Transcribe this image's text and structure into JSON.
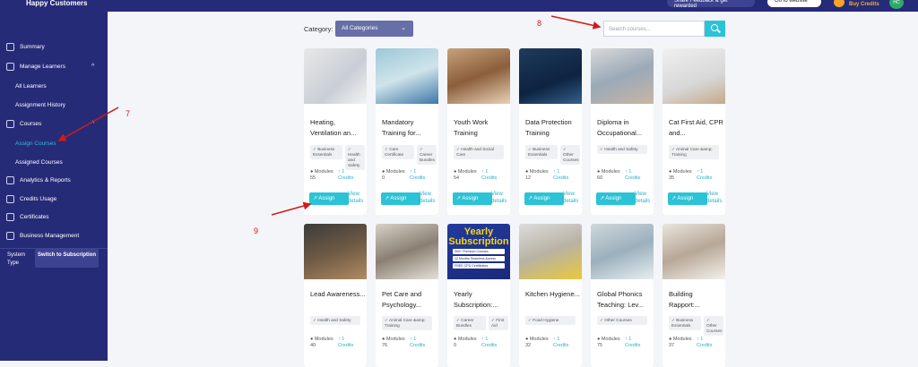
{
  "header": {
    "brand": "Happy Customers",
    "feedback_label": "Share Feedback & get rewarded",
    "goto_label": "Go to website",
    "buy_credits": "Buy Credits",
    "avatar_initials": "HC"
  },
  "sidebar": {
    "items": [
      {
        "label": "Summary"
      },
      {
        "label": "Manage Learners"
      },
      {
        "label": "All Learners"
      },
      {
        "label": "Assignment History"
      },
      {
        "label": "Courses"
      },
      {
        "label": "Assign Courses"
      },
      {
        "label": "Assigned Courses"
      },
      {
        "label": "Analytics & Reports"
      },
      {
        "label": "Credits Usage"
      },
      {
        "label": "Certificates"
      },
      {
        "label": "Business Management"
      }
    ],
    "system_type_label": "System Type",
    "switch_label": "Switch to Subscription"
  },
  "filter": {
    "category_label": "Category:",
    "selected": "All Categories"
  },
  "search": {
    "placeholder": "Search courses..."
  },
  "annotations": [
    "7",
    "8",
    "9"
  ],
  "course_common": {
    "modules_label": "Modules",
    "credits_label": "Credits",
    "assign_label": "Assign",
    "view_label": "View details"
  },
  "courses": [
    {
      "title": "Heating, Ventilation an...",
      "tags": [
        "Business Essentials",
        "Health and Safety"
      ],
      "modules": "55",
      "credits": "1"
    },
    {
      "title": "Mandatory Training for...",
      "tags": [
        "Care Certificate",
        "Career Bundles"
      ],
      "modules": "0",
      "credits": "1"
    },
    {
      "title": "Youth Work Training",
      "tags": [
        "Health and Social Care"
      ],
      "modules": "54",
      "credits": "1"
    },
    {
      "title": "Data Protection Training",
      "tags": [
        "Business Essentials",
        "Other Courses"
      ],
      "modules": "12",
      "credits": "1"
    },
    {
      "title": "Diploma in Occupational...",
      "tags": [
        "Health and Safety"
      ],
      "modules": "60",
      "credits": "1"
    },
    {
      "title": "Cat First Aid, CPR and...",
      "tags": [
        "Animal Care &amp; Training"
      ],
      "modules": "35",
      "credits": "1"
    },
    {
      "title": "Lead Awareness...",
      "tags": [
        "Health and Safety"
      ],
      "modules": "40",
      "credits": "1"
    },
    {
      "title": "Pet Care and Psychology...",
      "tags": [
        "Animal Care &amp; Training"
      ],
      "modules": "76",
      "credits": "1"
    },
    {
      "title": "Yearly Subscription:...",
      "tags": [
        "Career Bundles",
        "First Aid"
      ],
      "modules": "0",
      "credits": "1"
    },
    {
      "title": "Kitchen Hygiene...",
      "tags": [
        "Food Hygiene"
      ],
      "modules": "32",
      "credits": "1"
    },
    {
      "title": "Global Phonics Teaching: Lev...",
      "tags": [
        "Other Courses"
      ],
      "modules": "75",
      "credits": "1"
    },
    {
      "title": "Building Rapport:...",
      "tags": [
        "Business Essentials",
        "Other Courses"
      ],
      "modules": "37",
      "credits": "1"
    }
  ],
  "yearly_banner": {
    "title": "Yearly Subscription",
    "lines": [
      "300+ Premium Courses",
      "12 Months Seamless Access",
      "FREE CPD Certificates"
    ]
  },
  "colors": {
    "sidebar": "#262b78",
    "accent": "#2bc3d5",
    "annotation": "#d21a1a"
  }
}
